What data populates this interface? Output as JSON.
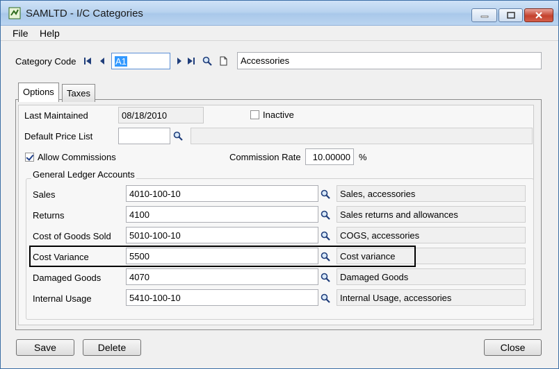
{
  "window": {
    "title": "SAMLTD - I/C Categories"
  },
  "menu": [
    {
      "label": "File"
    },
    {
      "label": "Help"
    }
  ],
  "header": {
    "category_code_label": "Category Code",
    "category_code_value": "A1",
    "category_description": "Accessories"
  },
  "tabs": [
    {
      "label": "Options",
      "active": true
    },
    {
      "label": "Taxes",
      "active": false
    }
  ],
  "options": {
    "last_maintained_label": "Last Maintained",
    "last_maintained_value": "08/18/2010",
    "inactive_label": "Inactive",
    "inactive_checked": false,
    "default_price_list_label": "Default Price List",
    "default_price_list_value": "",
    "default_price_list_desc": "",
    "allow_commissions_label": "Allow Commissions",
    "allow_commissions_checked": true,
    "commission_rate_label": "Commission Rate",
    "commission_rate_value": "10.00000",
    "commission_rate_unit": "%"
  },
  "gl": {
    "group_title": "General Ledger Accounts",
    "rows": [
      {
        "label": "Sales",
        "account": "4010-100-10",
        "description": "Sales, accessories"
      },
      {
        "label": "Returns",
        "account": "4100",
        "description": "Sales returns and allowances"
      },
      {
        "label": "Cost of Goods Sold",
        "account": "5010-100-10",
        "description": "COGS, accessories"
      },
      {
        "label": "Cost Variance",
        "account": "5500",
        "description": "Cost variance"
      },
      {
        "label": "Damaged Goods",
        "account": "4070",
        "description": "Damaged Goods"
      },
      {
        "label": "Internal Usage",
        "account": "5410-100-10",
        "description": "Internal Usage, accessories"
      }
    ]
  },
  "buttons": {
    "save": "Save",
    "delete": "Delete",
    "close": "Close"
  },
  "icons": {
    "app": "app-icon",
    "first": "first-record-icon",
    "previous": "previous-record-icon",
    "next": "next-record-icon",
    "last": "last-record-icon",
    "finder": "search-icon",
    "new": "new-document-icon"
  }
}
